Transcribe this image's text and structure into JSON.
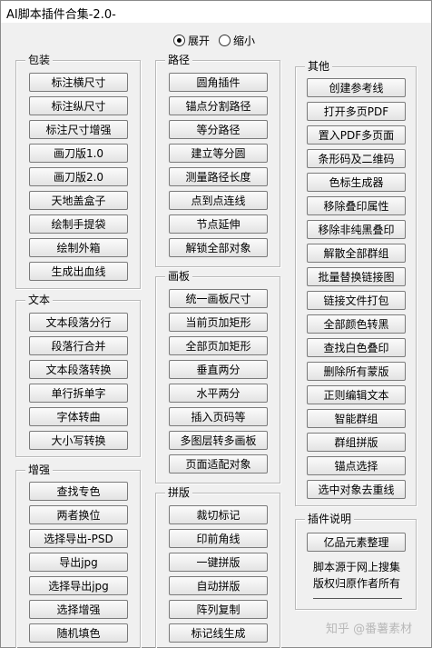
{
  "window": {
    "title": "AI脚本插件合集-2.0-"
  },
  "view_mode": {
    "options": [
      {
        "label": "展开",
        "selected": true
      },
      {
        "label": "缩小",
        "selected": false
      }
    ]
  },
  "groups": {
    "packaging": {
      "title": "包装",
      "buttons": [
        "标注横尺寸",
        "标注纵尺寸",
        "标注尺寸增强",
        "画刀版1.0",
        "画刀版2.0",
        "天地盖盒子",
        "绘制手提袋",
        "绘制外箱",
        "生成出血线"
      ]
    },
    "text": {
      "title": "文本",
      "buttons": [
        "文本段落分行",
        "段落行合并",
        "文本段落转换",
        "单行拆单字",
        "字体转曲",
        "大小写转换"
      ]
    },
    "enhance": {
      "title": "增强",
      "buttons": [
        "查找专色",
        "两者换位",
        "选择导出-PSD",
        "导出jpg",
        "选择导出jpg",
        "选择增强",
        "随机填色"
      ]
    },
    "path": {
      "title": "路径",
      "buttons": [
        "圆角插件",
        "锚点分割路径",
        "等分路径",
        "建立等分圆",
        "测量路径长度",
        "点到点连线",
        "节点延伸",
        "解锁全部对象"
      ]
    },
    "artboard": {
      "title": "画板",
      "buttons": [
        "统一画板尺寸",
        "当前页加矩形",
        "全部页加矩形",
        "垂直两分",
        "水平两分",
        "插入页码等",
        "多图层转多画板",
        "页面适配对象"
      ]
    },
    "imposition": {
      "title": "拼版",
      "buttons": [
        "裁切标记",
        "印前角线",
        "一键拼版",
        "自动拼版",
        "阵列复制",
        "标记线生成"
      ]
    },
    "other": {
      "title": "其他",
      "buttons": [
        "创建参考线",
        "打开多页PDF",
        "置入PDF多页面",
        "条形码及二维码",
        "色标生成器",
        "移除叠印属性",
        "移除非纯黑叠印",
        "解散全部群组",
        "批量替换链接图",
        "链接文件打包",
        "全部颜色转黑",
        "查找白色叠印",
        "删除所有蒙版",
        "正则编辑文本",
        "智能群组",
        "群组拼版",
        "锚点选择",
        "选中对象去重线"
      ]
    },
    "plugin_info": {
      "title": "插件说明",
      "button": "亿品元素整理",
      "lines": [
        "脚本源于网上搜集",
        "版权归原作者所有"
      ]
    }
  },
  "watermark": "知乎 @番薯素材"
}
